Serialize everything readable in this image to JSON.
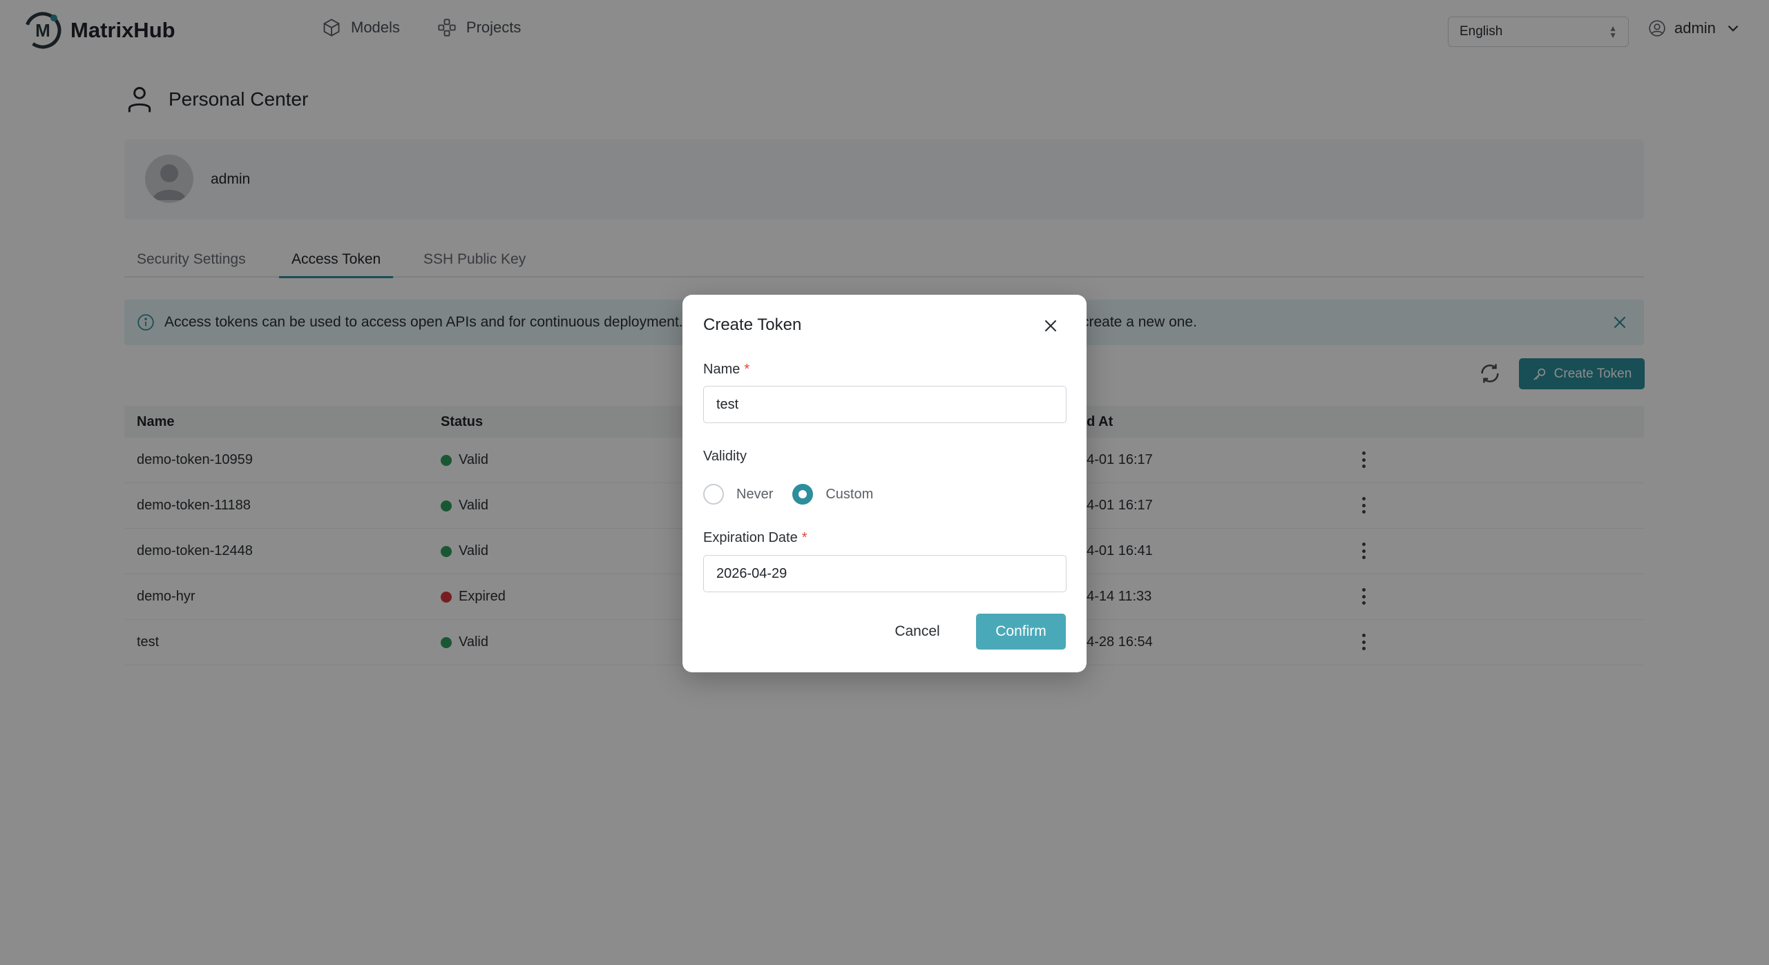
{
  "app": {
    "name": "MatrixHub"
  },
  "nav": {
    "models": "Models",
    "projects": "Projects"
  },
  "header": {
    "language": "English",
    "user": "admin"
  },
  "page": {
    "title": "Personal Center",
    "username": "admin"
  },
  "tabs": [
    {
      "label": "Security Settings",
      "active": false
    },
    {
      "label": "Access Token",
      "active": true
    },
    {
      "label": "SSH Public Key",
      "active": false
    }
  ],
  "info": {
    "text_left": "Access tokens can be used to access open APIs and for continuous deployment. A",
    "text_right": "create a new one."
  },
  "toolbar": {
    "create_label": "Create Token"
  },
  "table": {
    "columns": {
      "name": "Name",
      "status": "Status",
      "created": "ed At"
    },
    "rows": [
      {
        "name": "demo-token-10959",
        "status": "Valid",
        "created": "04-01 16:17"
      },
      {
        "name": "demo-token-11188",
        "status": "Valid",
        "created": "04-01 16:17"
      },
      {
        "name": "demo-token-12448",
        "status": "Valid",
        "created": "04-01 16:41"
      },
      {
        "name": "demo-hyr",
        "status": "Expired",
        "created": "04-14 11:33"
      },
      {
        "name": "test",
        "status": "Valid",
        "created": "04-28 16:54"
      }
    ]
  },
  "modal": {
    "title": "Create Token",
    "name_label": "Name",
    "name_value": "test",
    "validity_label": "Validity",
    "option_never": "Never",
    "option_custom": "Custom",
    "selected_option": "Custom",
    "expiration_label": "Expiration Date",
    "expiration_value": "2026-04-29",
    "cancel_label": "Cancel",
    "confirm_label": "Confirm",
    "required_mark": "*"
  },
  "colors": {
    "accent": "#2d8e9c",
    "confirm": "#4aa9b8",
    "valid": "#2f9e5f",
    "expired": "#d9363e"
  },
  "icons": [
    "matrixhub-logo",
    "cube-icon",
    "project-icon",
    "user-circle-icon",
    "chevron-down-icon",
    "person-icon",
    "avatar-icon",
    "info-icon",
    "close-icon",
    "refresh-icon",
    "key-icon",
    "more-vertical-icon"
  ]
}
